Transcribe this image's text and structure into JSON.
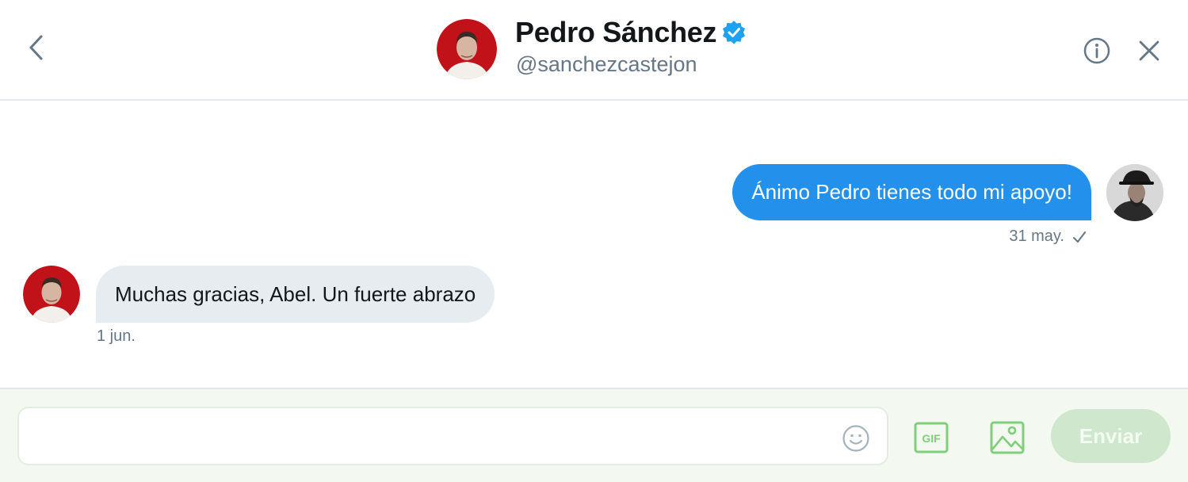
{
  "header": {
    "name": "Pedro Sánchez",
    "handle": "@sanchezcastejon"
  },
  "messages": [
    {
      "direction": "sent",
      "text": "Ánimo Pedro tienes todo mi apoyo!",
      "date": "31 may.",
      "status_icon": "checkmark-icon"
    },
    {
      "direction": "received",
      "text": "Muchas gracias, Abel. Un fuerte abrazo",
      "date": "1 jun."
    }
  ],
  "composer": {
    "placeholder": "",
    "send_label": "Enviar",
    "gif_label": "GIF"
  },
  "colors": {
    "sent_bubble": "#2391ec",
    "received_bubble": "#e6ecf0",
    "accent_green": "#7fcf7a",
    "verified_blue": "#1da1f2"
  },
  "icons": [
    "back-arrow-icon",
    "verified-badge-icon",
    "info-icon",
    "close-icon",
    "emoji-icon",
    "gif-icon",
    "image-icon"
  ]
}
